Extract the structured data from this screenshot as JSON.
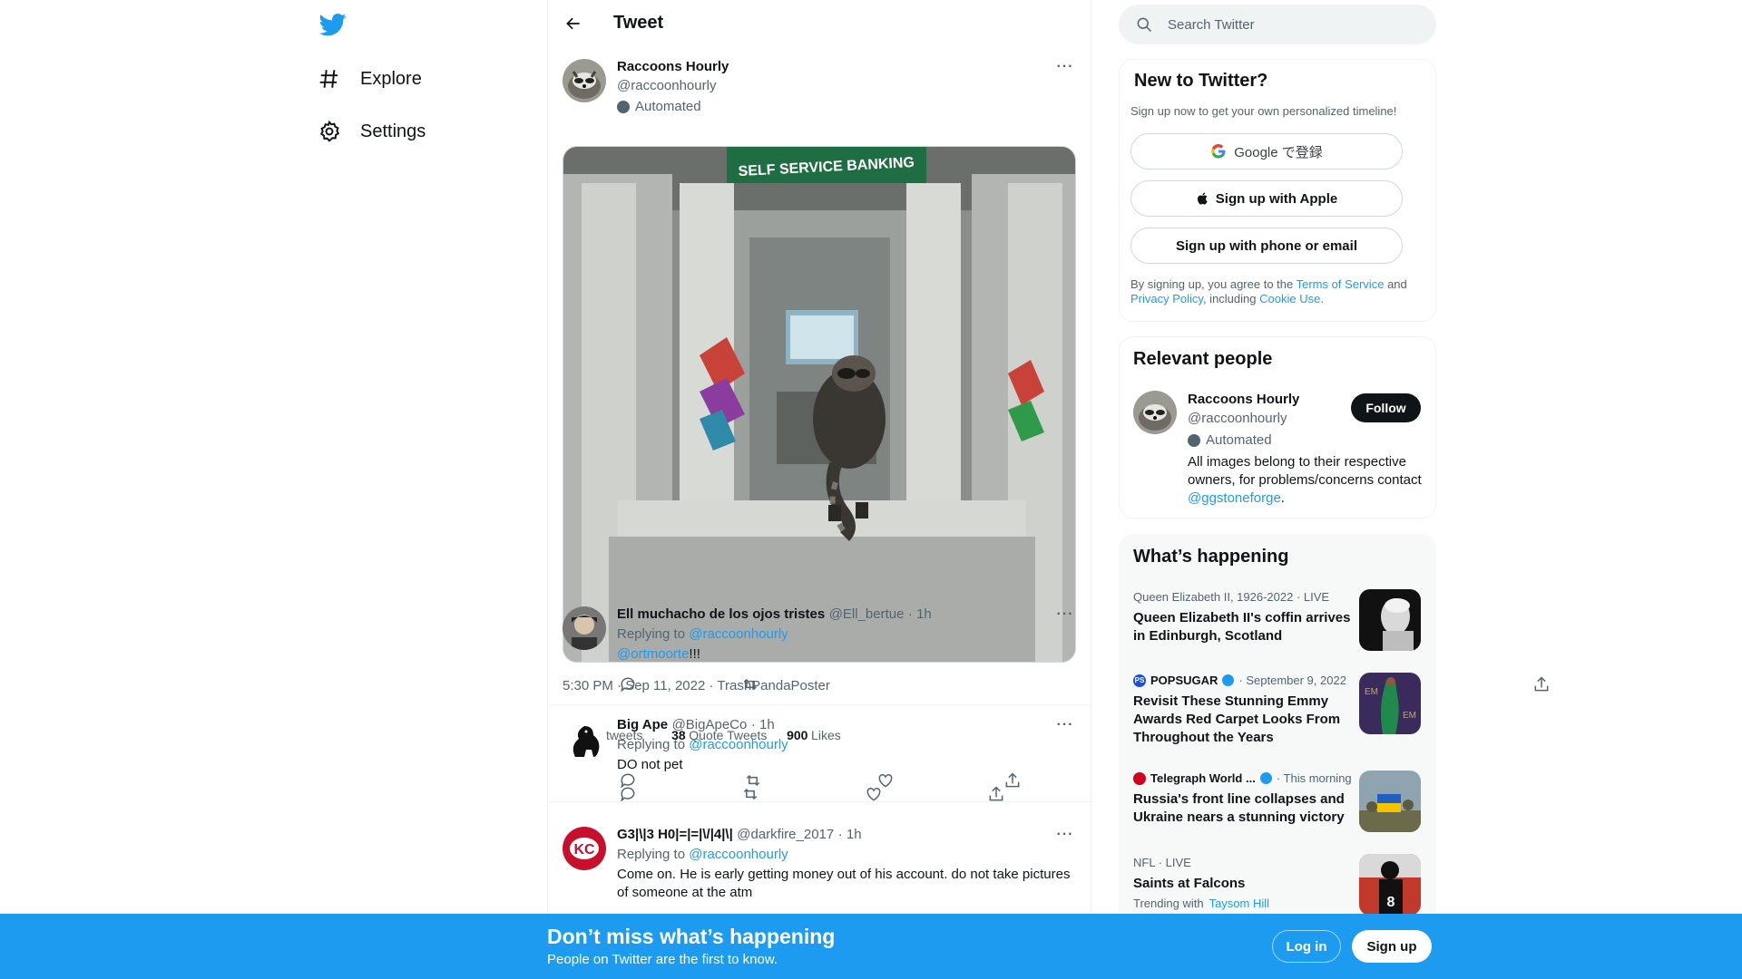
{
  "nav": {
    "logo": "twitter-bird-icon",
    "items": [
      {
        "label": "Explore",
        "icon": "hashtag-icon"
      },
      {
        "label": "Settings",
        "icon": "gear-icon"
      }
    ]
  },
  "header": {
    "title": "Tweet"
  },
  "tweet": {
    "author_name": "Raccoons Hourly",
    "author_handle": "@raccoonhourly",
    "automated_label": "Automated",
    "meta": "5:30 PM · Sep 11, 2022 · TrashPandaPoster",
    "stats": {
      "retweets_label": "tweets",
      "quotes_count": "38",
      "quotes_label": "Quote Tweets",
      "likes_count": "900",
      "likes_label": "Likes"
    }
  },
  "replies": [
    {
      "name": "Ell muchacho de los ojos tristes",
      "handle": "@Ell_bertue",
      "time": "· 1h",
      "replying_label": "Replying to",
      "replying_to": "@raccoonhourly",
      "text_link": "@ortmoorte",
      "text": "!!!"
    },
    {
      "name": "Big Ape",
      "handle": "@BigApeCo",
      "time": "· 1h",
      "replying_label": "Replying to",
      "replying_to": "@raccoonhourly",
      "text": "DO not pet"
    },
    {
      "name": "G3|\\|3 H0|=|=|\\/|4|\\|",
      "handle": "@darkfire_2017",
      "time": "· 1h",
      "replying_label": "Replying to",
      "replying_to": "@raccoonhourly",
      "text": "Come on. He is early getting money out of his account. do not take pictures of someone at the atm"
    }
  ],
  "search": {
    "placeholder": "Search Twitter"
  },
  "new_to_twitter": {
    "title": "New to Twitter?",
    "subtitle": "Sign up now to get your own personalized timeline!",
    "google_label": "Google で登録",
    "apple_label": "Sign up with Apple",
    "phone_label": "Sign up with phone or email",
    "legal_prefix": "By signing up, you agree to the",
    "terms": "Terms of Service",
    "and": "and",
    "privacy": "Privacy Policy",
    "including": ", including",
    "cookie": "Cookie Use."
  },
  "relevant": {
    "title": "Relevant people",
    "name": "Raccoons Hourly",
    "handle": "@raccoonhourly",
    "automated_label": "Automated",
    "follow_label": "Follow",
    "bio_prefix": "All images belong to their respective owners, for problems/concerns contact",
    "bio_link": "@ggstoneforge",
    "bio_suffix": "."
  },
  "happening": {
    "title": "What’s happening",
    "trends": [
      {
        "context": "Queen Elizabeth II, 1926-2022 · LIVE",
        "title": "Queen Elizabeth II's coffin arrives in Edinburgh, Scotland"
      },
      {
        "source": "POPSUGAR",
        "context_suffix": "· September 9, 2022",
        "title": "Revisit These Stunning Emmy Awards Red Carpet Looks From Throughout the Years"
      },
      {
        "source": "Telegraph World ...",
        "context_suffix": "· This morning",
        "title": "Russia's front line collapses and Ukraine nears a stunning victory"
      },
      {
        "context": "NFL · LIVE",
        "title": "Saints at Falcons",
        "trending_label": "Trending with",
        "trending_link": "Taysom Hill"
      }
    ]
  },
  "banner": {
    "title": "Don’t miss what’s happening",
    "subtitle": "People on Twitter are the first to know.",
    "login_label": "Log in",
    "signup_label": "Sign up"
  }
}
